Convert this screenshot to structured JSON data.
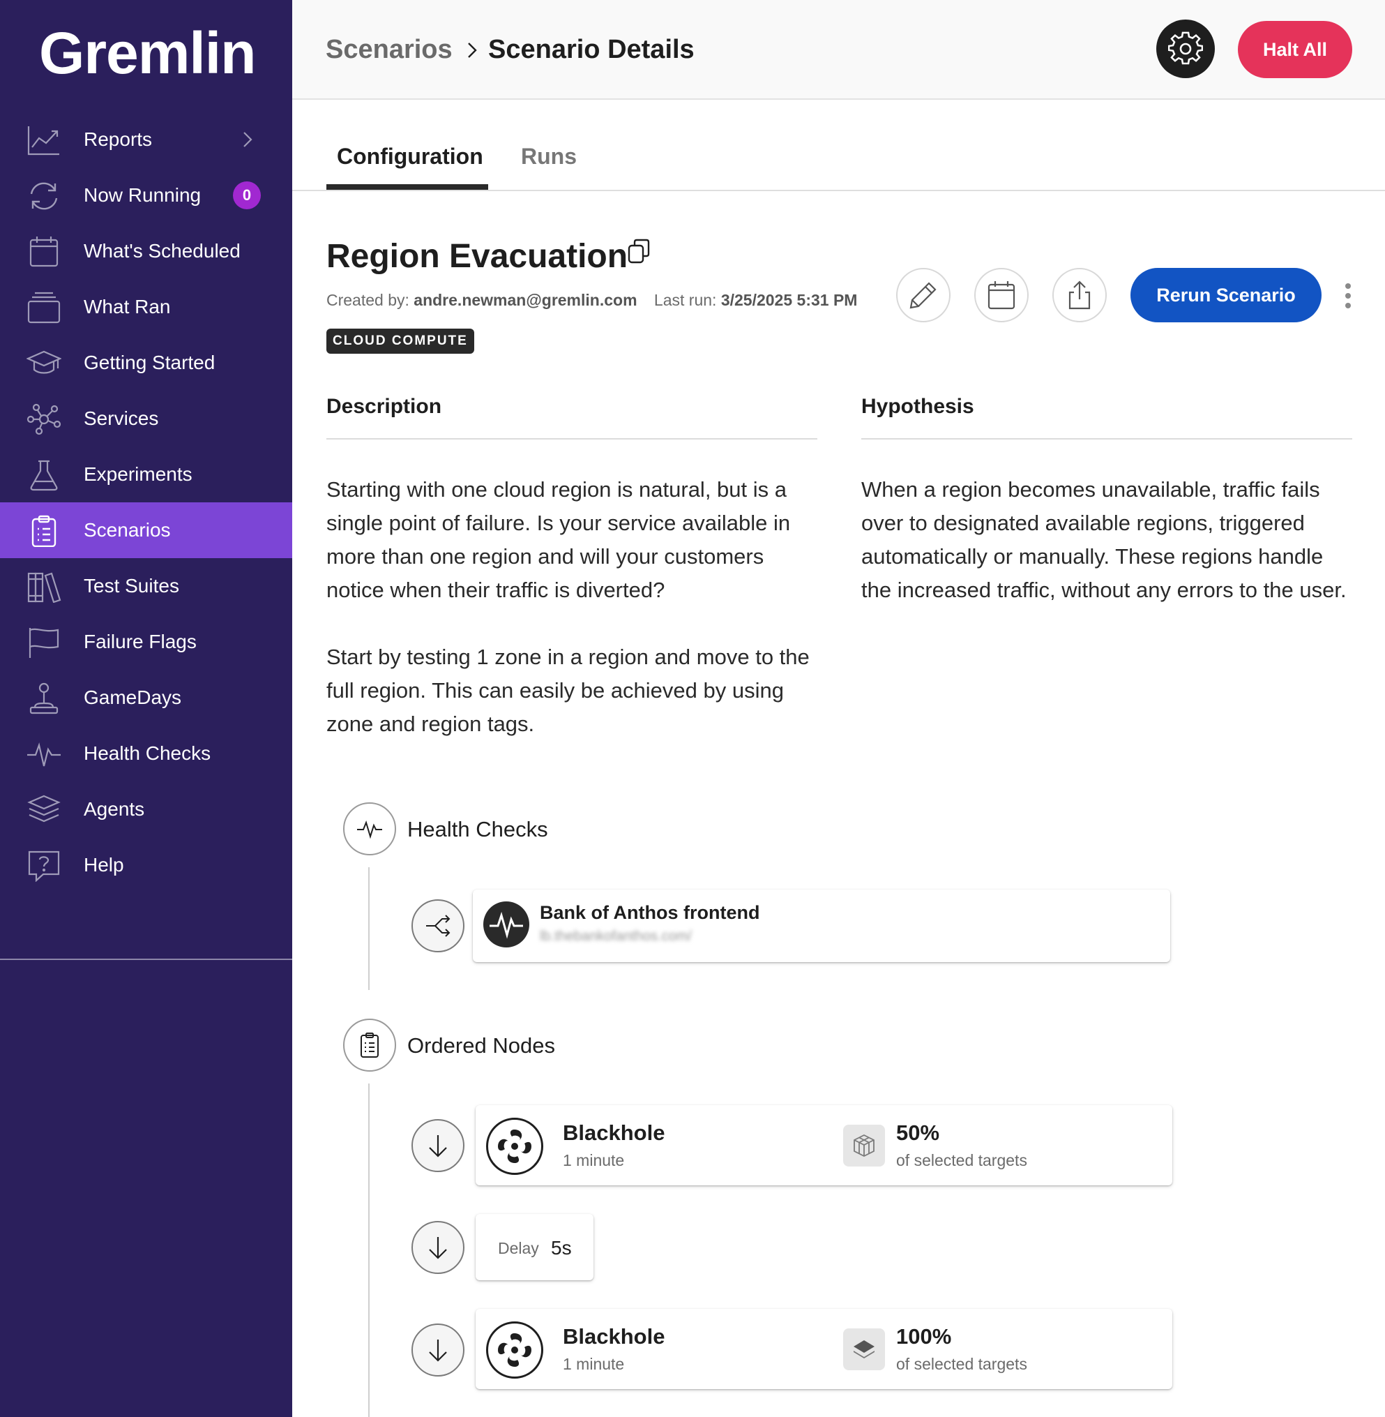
{
  "app": {
    "logo": "Gremlin"
  },
  "sidebar": {
    "items": [
      {
        "label": "Reports",
        "icon": "chart-line-icon"
      },
      {
        "label": "Now Running",
        "icon": "refresh-icon",
        "badge": "0"
      },
      {
        "label": "What's Scheduled",
        "icon": "calendar-icon"
      },
      {
        "label": "What Ran",
        "icon": "stack-icon"
      },
      {
        "label": "Getting Started",
        "icon": "graduation-cap-icon"
      },
      {
        "label": "Services",
        "icon": "network-icon"
      },
      {
        "label": "Experiments",
        "icon": "flask-icon"
      },
      {
        "label": "Scenarios",
        "icon": "clipboard-list-icon",
        "active": true
      },
      {
        "label": "Test Suites",
        "icon": "books-icon"
      },
      {
        "label": "Failure Flags",
        "icon": "flag-icon"
      },
      {
        "label": "GameDays",
        "icon": "joystick-icon"
      },
      {
        "label": "Health Checks",
        "icon": "pulse-icon"
      },
      {
        "label": "Agents",
        "icon": "layers-icon"
      },
      {
        "label": "Help",
        "icon": "help-icon"
      }
    ]
  },
  "header": {
    "breadcrumb": [
      "Scenarios",
      "Scenario Details"
    ],
    "halt_label": "Halt All"
  },
  "tabs": [
    {
      "label": "Configuration",
      "active": true
    },
    {
      "label": "Runs",
      "active": false
    }
  ],
  "scenario": {
    "title": "Region Evacuation",
    "created_by_label": "Created by:",
    "created_by": "andre.newman@gremlin.com",
    "last_run_label": "Last run:",
    "last_run": "3/25/2025 5:31 PM",
    "tag": "CLOUD COMPUTE",
    "rerun_label": "Rerun Scenario",
    "description_heading": "Description",
    "description_p1": "Starting with one cloud region is natural, but is a single point of failure. Is your service available in more than one region and will your customers notice when their traffic is diverted?",
    "description_p2": "Start by testing 1 zone in a region and move to the full region. This can easily be achieved by using zone and region tags.",
    "hypothesis_heading": "Hypothesis",
    "hypothesis": "When a region becomes unavailable, traffic fails over to designated available regions, triggered automatically or manually. These regions handle the increased traffic, without any errors to the user."
  },
  "flow": {
    "health_checks_label": "Health Checks",
    "health_check": {
      "name": "Bank of Anthos frontend",
      "url": "lb.thebankofanthos.com/"
    },
    "ordered_nodes_label": "Ordered Nodes",
    "nodes": [
      {
        "name": "Blackhole",
        "duration": "1 minute",
        "percent": "50%",
        "sub": "of selected targets"
      },
      {
        "delay_label": "Delay",
        "delay": "5s"
      },
      {
        "name": "Blackhole",
        "duration": "1 minute",
        "percent": "100%",
        "sub": "of selected targets"
      }
    ]
  },
  "colors": {
    "sidebar_bg": "#2b1f5c",
    "sidebar_active": "#7c45d6",
    "badge": "#a128d1",
    "halt": "#e5335a",
    "primary": "#1254c3"
  }
}
